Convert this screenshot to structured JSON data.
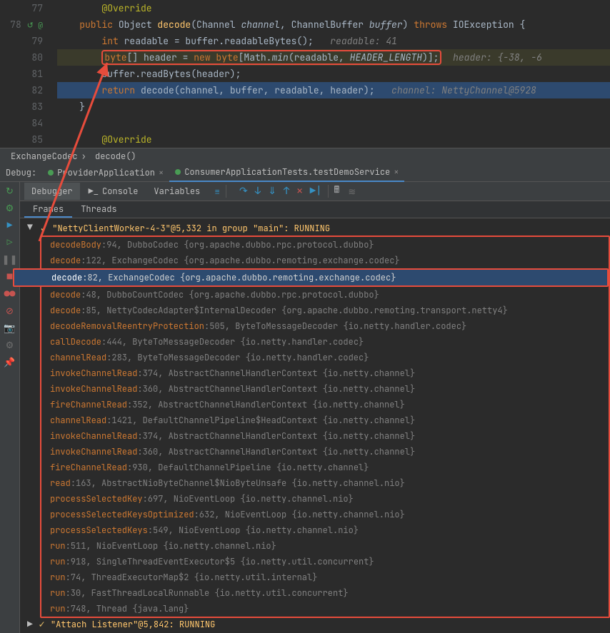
{
  "editor": {
    "lines": [
      {
        "num": "77",
        "tokens": [
          {
            "c": "ann",
            "t": "@Override"
          }
        ]
      },
      {
        "num": "78",
        "marker": "↺ @",
        "tokens": [
          {
            "c": "kw",
            "t": "public"
          },
          {
            "t": " Object "
          },
          {
            "c": "fn",
            "t": "decode"
          },
          {
            "t": "(Channel "
          },
          {
            "c": "param",
            "t": "channel"
          },
          {
            "t": ", ChannelBuffer "
          },
          {
            "c": "param",
            "t": "buffer"
          },
          {
            "t": ") "
          },
          {
            "c": "kw",
            "t": "throws"
          },
          {
            "t": " IOException {"
          }
        ]
      },
      {
        "num": "79",
        "tokens": [
          {
            "c": "kw",
            "t": "int"
          },
          {
            "t": " readable = buffer.readableBytes();   "
          },
          {
            "c": "comment",
            "t": "readable: 41"
          }
        ],
        "indent": 4
      },
      {
        "num": "80",
        "hl": "80",
        "box": true,
        "tokens": [
          {
            "c": "kw",
            "t": "byte"
          },
          {
            "t": "[] header = "
          },
          {
            "c": "kw",
            "t": "new byte"
          },
          {
            "t": "[Math."
          },
          {
            "c": "param",
            "t": "min"
          },
          {
            "t": "(readable, "
          },
          {
            "c": "param",
            "t": "HEADER_LENGTH"
          },
          {
            "t": ")];"
          }
        ],
        "suffix": {
          "c": "comment",
          "t": "  header: {-38, -6"
        },
        "indent": 4
      },
      {
        "num": "81",
        "tokens": [
          {
            "t": "buffer.readBytes(header);"
          }
        ],
        "indent": 4
      },
      {
        "num": "82",
        "hl": "82",
        "tokens": [
          {
            "c": "kw",
            "t": "return"
          },
          {
            "t": " decode(channel, buffer, readable, header);   "
          },
          {
            "c": "comment",
            "t": "channel: NettyChannel@5928"
          }
        ],
        "indent": 4
      },
      {
        "num": "83",
        "tokens": [
          {
            "t": "}"
          }
        ]
      },
      {
        "num": "84",
        "tokens": [
          {
            "t": ""
          }
        ]
      },
      {
        "num": "85",
        "tokens": [
          {
            "c": "ann",
            "t": "@Override"
          }
        ]
      }
    ]
  },
  "breadcrumb": {
    "a": "ExchangeCodec",
    "b": "decode()"
  },
  "debug": {
    "label": "Debug:",
    "tabs": [
      {
        "label": "ProviderApplication",
        "active": false
      },
      {
        "label": "ConsumerApplicationTests.testDemoService",
        "active": true
      }
    ],
    "subtabs": {
      "a": "Debugger",
      "b": "Console",
      "c": "Variables"
    },
    "frametabs": {
      "a": "Frames",
      "b": "Threads"
    },
    "thread": "\"NettyClientWorker-4-3\"@5,332 in group \"main\": RUNNING",
    "thread2": "\"Attach Listener\"@5,842: RUNNING",
    "frames": [
      {
        "m": "decodeBody",
        "l": ":94, DubboCodec {org.apache.dubbo.rpc.protocol.dubbo}"
      },
      {
        "m": "decode",
        "l": ":122, ExchangeCodec {org.apache.dubbo.remoting.exchange.codec}"
      },
      {
        "m": "decode",
        "l": ":82, ExchangeCodec {org.apache.dubbo.remoting.exchange.codec}",
        "sel": true
      },
      {
        "m": "decode",
        "l": ":48, DubboCountCodec {org.apache.dubbo.rpc.protocol.dubbo}"
      },
      {
        "m": "decode",
        "l": ":85, NettyCodecAdapter$InternalDecoder {org.apache.dubbo.remoting.transport.netty4}"
      },
      {
        "m": "decodeRemovalReentryProtection",
        "l": ":505, ByteToMessageDecoder {io.netty.handler.codec}"
      },
      {
        "m": "callDecode",
        "l": ":444, ByteToMessageDecoder {io.netty.handler.codec}"
      },
      {
        "m": "channelRead",
        "l": ":283, ByteToMessageDecoder {io.netty.handler.codec}"
      },
      {
        "m": "invokeChannelRead",
        "l": ":374, AbstractChannelHandlerContext {io.netty.channel}"
      },
      {
        "m": "invokeChannelRead",
        "l": ":360, AbstractChannelHandlerContext {io.netty.channel}"
      },
      {
        "m": "fireChannelRead",
        "l": ":352, AbstractChannelHandlerContext {io.netty.channel}"
      },
      {
        "m": "channelRead",
        "l": ":1421, DefaultChannelPipeline$HeadContext {io.netty.channel}"
      },
      {
        "m": "invokeChannelRead",
        "l": ":374, AbstractChannelHandlerContext {io.netty.channel}"
      },
      {
        "m": "invokeChannelRead",
        "l": ":360, AbstractChannelHandlerContext {io.netty.channel}"
      },
      {
        "m": "fireChannelRead",
        "l": ":930, DefaultChannelPipeline {io.netty.channel}"
      },
      {
        "m": "read",
        "l": ":163, AbstractNioByteChannel$NioByteUnsafe {io.netty.channel.nio}"
      },
      {
        "m": "processSelectedKey",
        "l": ":697, NioEventLoop {io.netty.channel.nio}"
      },
      {
        "m": "processSelectedKeysOptimized",
        "l": ":632, NioEventLoop {io.netty.channel.nio}"
      },
      {
        "m": "processSelectedKeys",
        "l": ":549, NioEventLoop {io.netty.channel.nio}"
      },
      {
        "m": "run",
        "l": ":511, NioEventLoop {io.netty.channel.nio}"
      },
      {
        "m": "run",
        "l": ":918, SingleThreadEventExecutor$5 {io.netty.util.concurrent}"
      },
      {
        "m": "run",
        "l": ":74, ThreadExecutorMap$2 {io.netty.util.internal}"
      },
      {
        "m": "run",
        "l": ":30, FastThreadLocalRunnable {io.netty.util.concurrent}"
      },
      {
        "m": "run",
        "l": ":748, Thread {java.lang}"
      }
    ]
  }
}
